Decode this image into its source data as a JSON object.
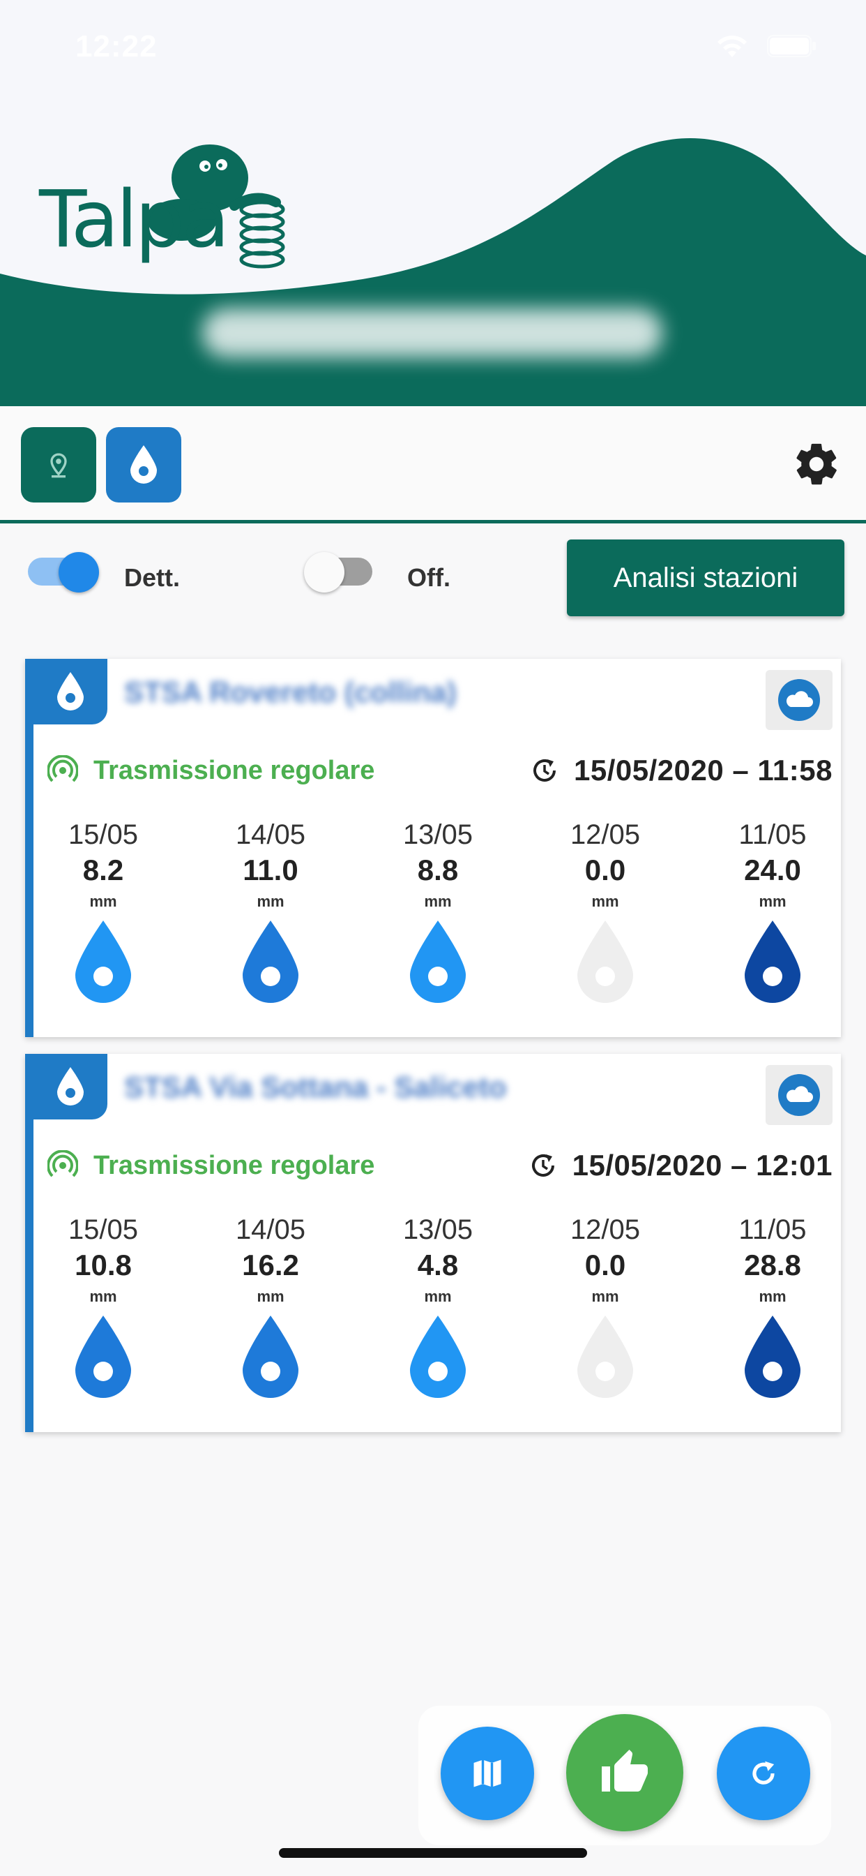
{
  "status_bar": {
    "time": "12:22",
    "wifi_icon": "wifi-icon",
    "battery_icon": "battery-icon"
  },
  "header": {
    "logo_text": "Talpa",
    "station_label": "",
    "colors": {
      "brand": "#0b6b5b"
    }
  },
  "toolbar": {
    "location_icon": "location-pin-icon",
    "drop_icon": "water-drop-icon",
    "settings_icon": "gear-icon"
  },
  "controls": {
    "details_label": "Dett.",
    "details_on": true,
    "offline_label": "Off.",
    "offline_on": false,
    "analysis_button": "Analisi stazioni"
  },
  "stations": [
    {
      "name": "STSA Rovereto (collina)",
      "status": "Trasmissione regolare",
      "last_update": "15/05/2020 – 11:58",
      "readings": [
        {
          "date": "15/05",
          "value": "8.2",
          "unit": "mm",
          "color": "#2196f3"
        },
        {
          "date": "14/05",
          "value": "11.0",
          "unit": "mm",
          "color": "#1e7ad9"
        },
        {
          "date": "13/05",
          "value": "8.8",
          "unit": "mm",
          "color": "#2196f3"
        },
        {
          "date": "12/05",
          "value": "0.0",
          "unit": "mm",
          "color": "#eeeeee"
        },
        {
          "date": "11/05",
          "value": "24.0",
          "unit": "mm",
          "color": "#0d47a1"
        }
      ]
    },
    {
      "name": "STSA Via Sottana - Saliceto",
      "status": "Trasmissione regolare",
      "last_update": "15/05/2020 – 12:01",
      "readings": [
        {
          "date": "15/05",
          "value": "10.8",
          "unit": "mm",
          "color": "#1e7ad9"
        },
        {
          "date": "14/05",
          "value": "16.2",
          "unit": "mm",
          "color": "#1e7ad9"
        },
        {
          "date": "13/05",
          "value": "4.8",
          "unit": "mm",
          "color": "#2196f3"
        },
        {
          "date": "12/05",
          "value": "0.0",
          "unit": "mm",
          "color": "#eeeeee"
        },
        {
          "date": "11/05",
          "value": "28.8",
          "unit": "mm",
          "color": "#0d47a1"
        }
      ]
    }
  ],
  "fabs": {
    "map_icon": "map-icon",
    "thumb_icon": "thumbs-up-icon",
    "refresh_icon": "refresh-icon"
  }
}
